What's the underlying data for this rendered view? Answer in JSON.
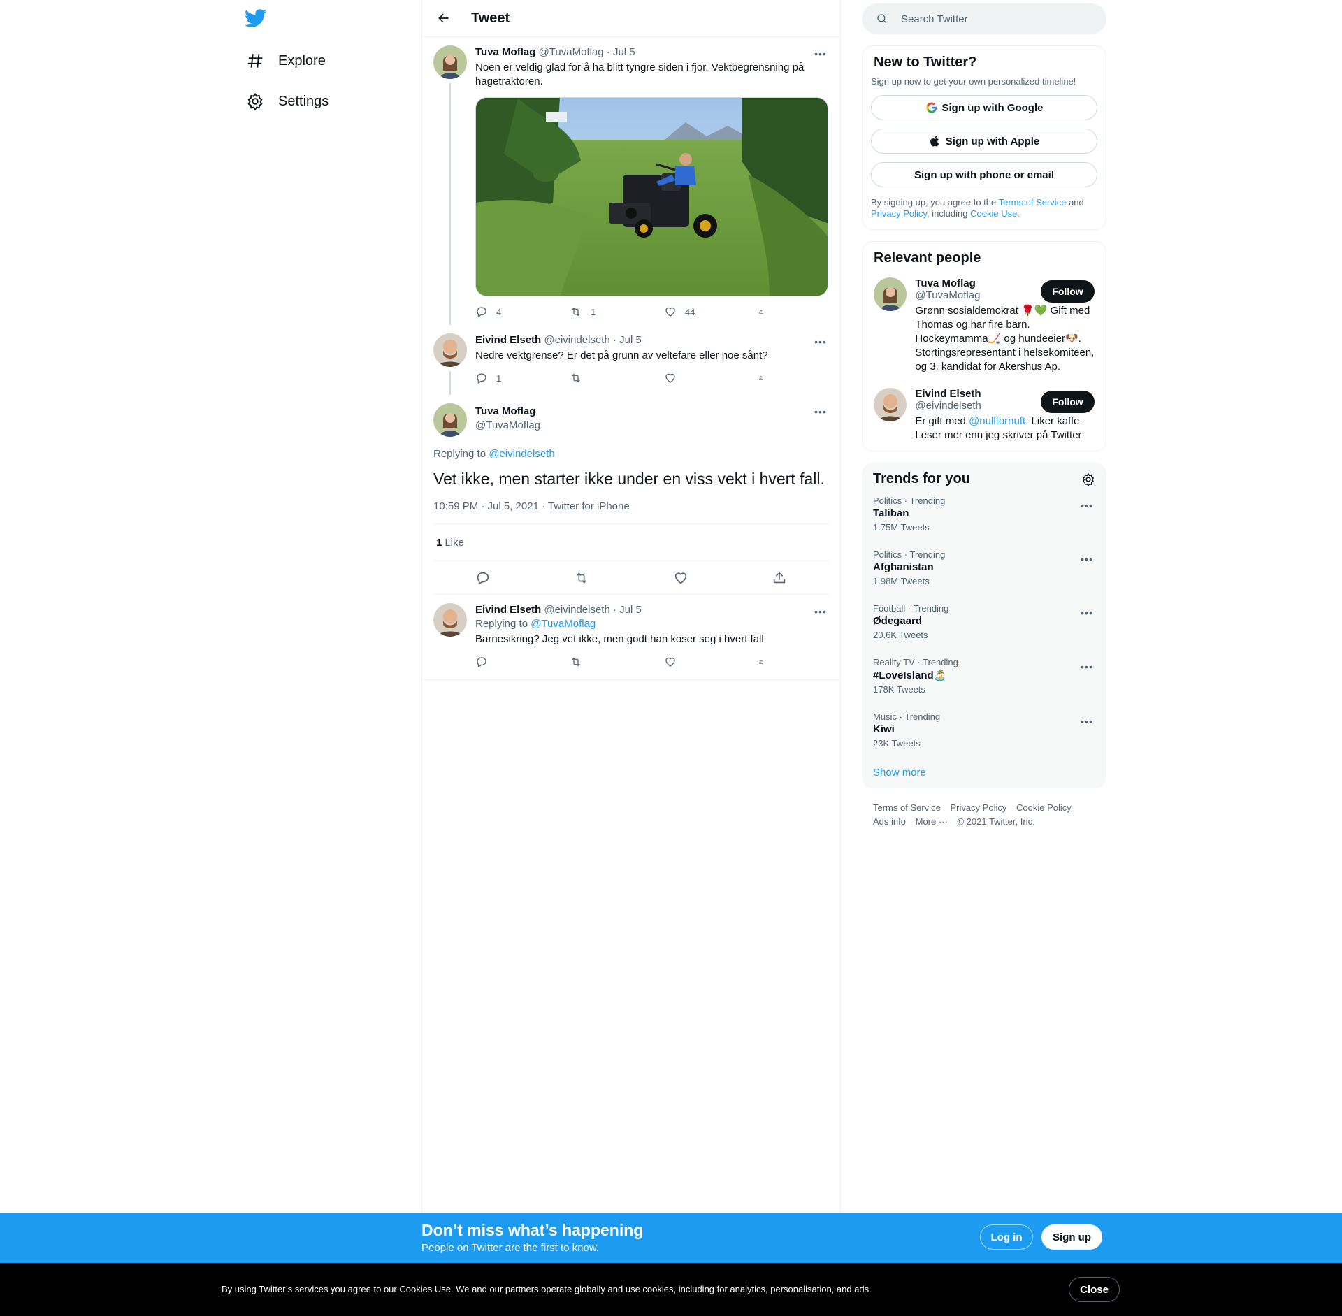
{
  "nav": {
    "explore_label": "Explore",
    "settings_label": "Settings"
  },
  "header": {
    "title": "Tweet"
  },
  "thread": {
    "tweet1": {
      "name": "Tuva Moflag",
      "handle": "@TuvaMoflag",
      "date": "· Jul 5",
      "text": "Noen er veldig glad for å ha blitt tyngre siden i fjor. Vektbegrensning på hagetraktoren.",
      "replies": "4",
      "retweets": "1",
      "likes": "44"
    },
    "tweet2": {
      "name": "Eivind Elseth",
      "handle": "@eivindelseth",
      "date": "· Jul 5",
      "text": "Nedre vektgrense? Er det på grunn av veltefare eller noe sånt?",
      "replies": "1"
    },
    "focused": {
      "name": "Tuva Moflag",
      "handle": "@TuvaMoflag",
      "replying_prefix": "Replying to",
      "replying_to": "@eivindelseth",
      "text": "Vet ikke, men starter ikke under en viss vekt i hvert fall.",
      "timestamp": "10:59 PM · Jul 5, 2021 · Twitter for iPhone",
      "like_count": "1",
      "like_label": "Like"
    },
    "reply": {
      "name": "Eivind Elseth",
      "handle": "@eivindelseth",
      "date": "· Jul 5",
      "replying_prefix": "Replying to",
      "replying_to": "@TuvaMoflag",
      "text": "Barnesikring? Jeg vet ikke, men godt han koser seg i hvert fall"
    }
  },
  "search": {
    "placeholder": "Search Twitter"
  },
  "new_to_twitter": {
    "title": "New to Twitter?",
    "subtitle": "Sign up now to get your own personalized timeline!",
    "google": "Sign up with Google",
    "apple": "Sign up with Apple",
    "phone": "Sign up with phone or email",
    "legal_1": "By signing up, you agree to the",
    "terms": "Terms of Service",
    "legal_2": "and",
    "privacy": "Privacy Policy",
    "legal_3": ", including",
    "cookie": "Cookie Use."
  },
  "relevant_people": {
    "title": "Relevant people",
    "people": [
      {
        "name": "Tuva Moflag",
        "handle": "@TuvaMoflag",
        "bio": "Grønn sosialdemokrat 🌹💚 Gift med Thomas og har fire barn. Hockeymamma🏒 og hundeeier🐶. Stortingsrepresentant i helsekomiteen, og 3. kandidat for Akershus Ap.",
        "follow": "Follow"
      },
      {
        "name": "Eivind Elseth",
        "handle": "@eivindelseth",
        "bio_1": "Er gift med",
        "bio_link": "@nullfornuft",
        "bio_2": ". Liker kaffe. Leser mer enn jeg skriver på Twitter",
        "follow": "Follow"
      }
    ]
  },
  "trends": {
    "title": "Trends for you",
    "items": [
      {
        "category": "Politics · Trending",
        "name": "Taliban",
        "count": "1.75M Tweets"
      },
      {
        "category": "Politics · Trending",
        "name": "Afghanistan",
        "count": "1.98M Tweets"
      },
      {
        "category": "Football · Trending",
        "name": "Ødegaard",
        "count": "20.6K Tweets"
      },
      {
        "category": "Reality TV · Trending",
        "name": "#LoveIsland🏝️",
        "count": "178K Tweets"
      },
      {
        "category": "Music · Trending",
        "name": "Kiwi",
        "count": "23K Tweets"
      }
    ],
    "show_more": "Show more"
  },
  "footer": {
    "terms": "Terms of Service",
    "privacy": "Privacy Policy",
    "cookie": "Cookie Policy",
    "ads": "Ads info",
    "more": "More ···",
    "copyright": "© 2021 Twitter, Inc."
  },
  "banner": {
    "title": "Don’t miss what’s happening",
    "subtitle": "People on Twitter are the first to know.",
    "login": "Log in",
    "signup": "Sign up"
  },
  "cookie_bar": {
    "text": "By using Twitter’s services you agree to our Cookies Use. We and our partners operate globally and use cookies, including for analytics, personalisation, and ads.",
    "close": "Close"
  },
  "colors": {
    "accent": "#1d9bf0",
    "text": "#0f1419",
    "muted": "#536471",
    "border": "#eff3f4"
  }
}
